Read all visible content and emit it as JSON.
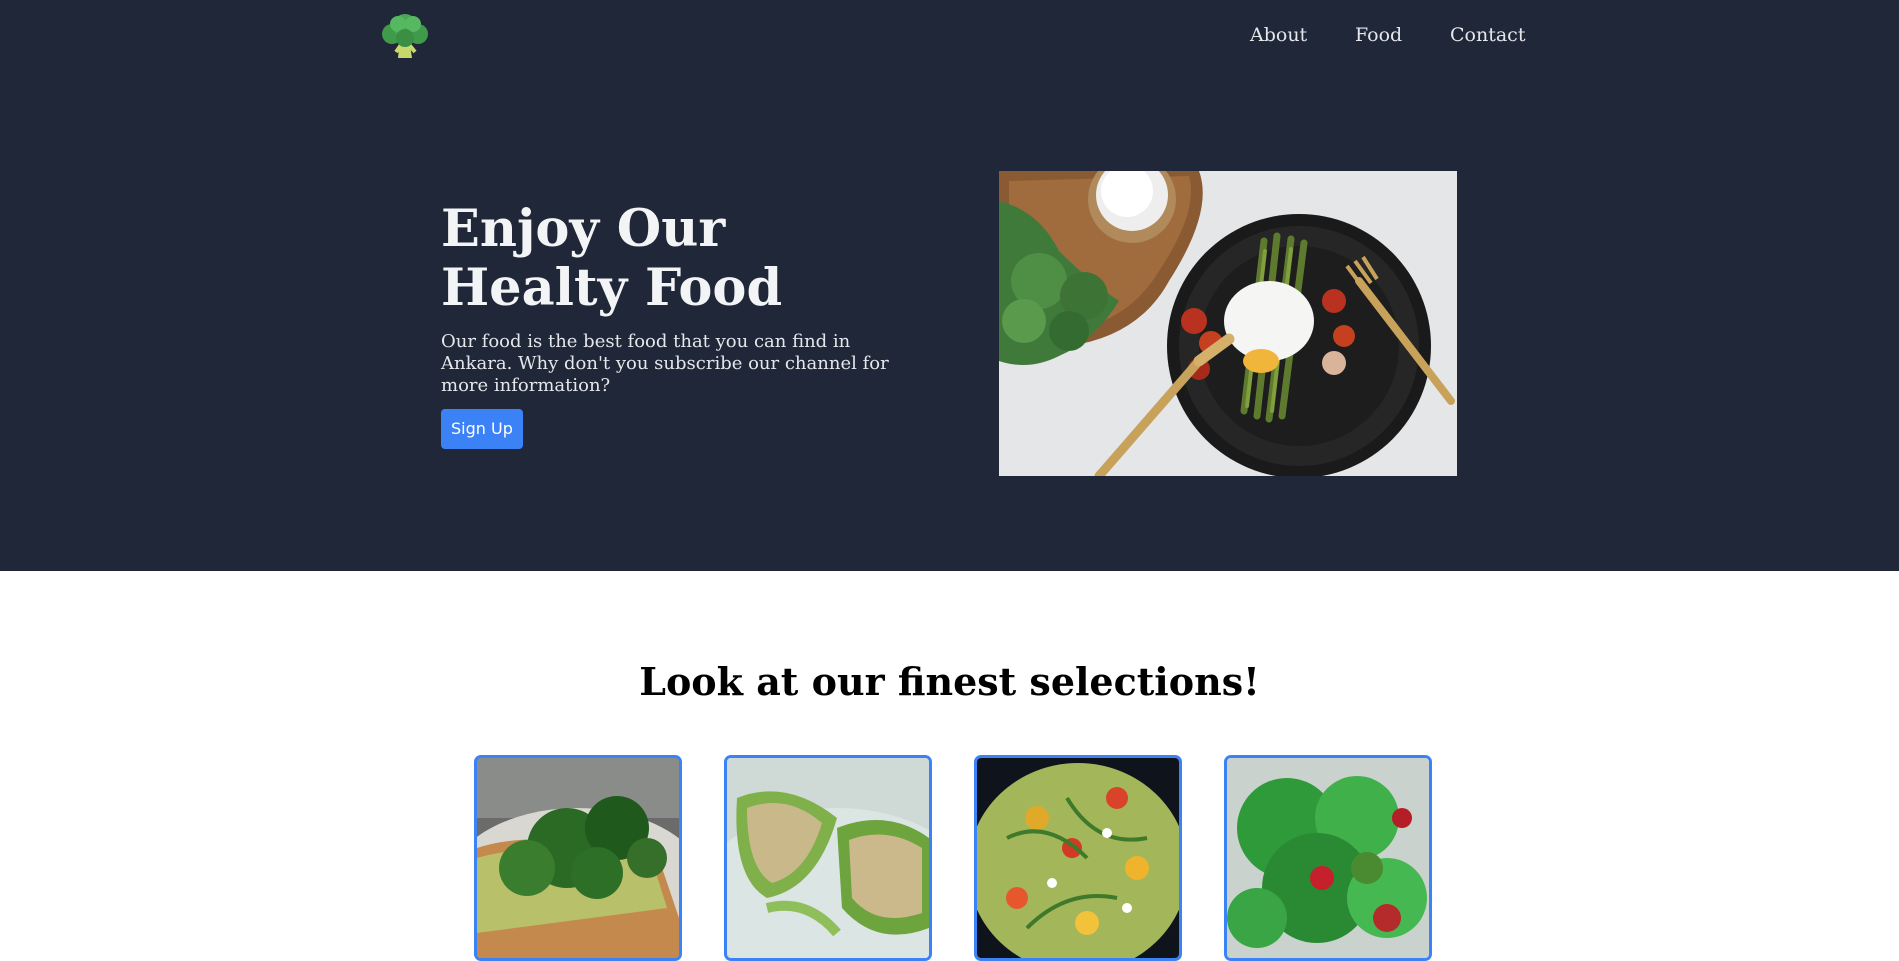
{
  "nav": {
    "logo_icon": "broccoli-icon",
    "items": [
      "About",
      "Food",
      "Contact"
    ]
  },
  "hero": {
    "title_line1": "Enjoy Our",
    "title_line2": "Healty Food",
    "description": "Our food is the best food that you can find in Ankara. Why don't you subscribe our channel for more information?",
    "button_label": "Sign Up",
    "image": "plate-asparagus-poached-egg-image"
  },
  "selections": {
    "title": "Look at our finest selections!",
    "cards": [
      {
        "image": "avocado-spinach-toast-image"
      },
      {
        "image": "stuffed-green-pepper-image"
      },
      {
        "image": "arugula-tomato-avocado-image"
      },
      {
        "image": "green-salad-image"
      }
    ]
  },
  "colors": {
    "header_bg": "#1f2738",
    "accent": "#3b82f6",
    "text_light": "#f3f4f6"
  }
}
